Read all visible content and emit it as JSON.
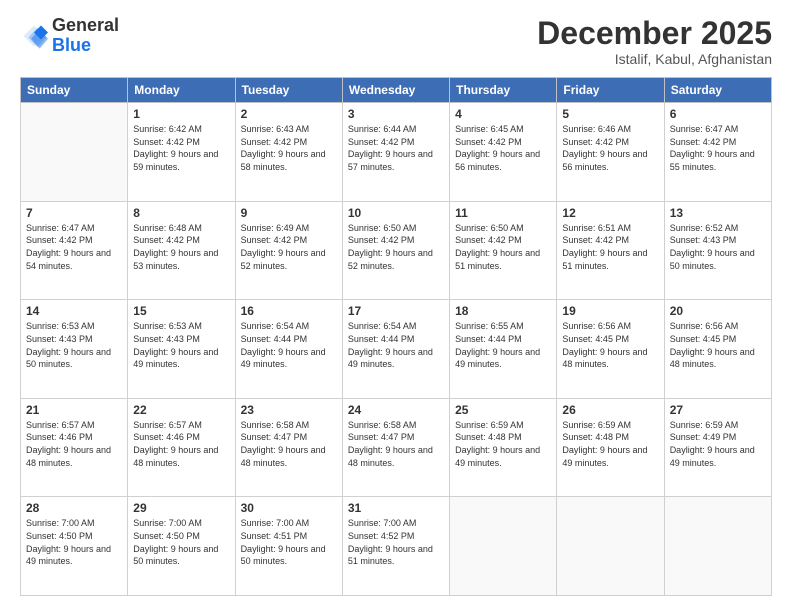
{
  "header": {
    "logo_general": "General",
    "logo_blue": "Blue",
    "month_title": "December 2025",
    "location": "Istalif, Kabul, Afghanistan"
  },
  "days_of_week": [
    "Sunday",
    "Monday",
    "Tuesday",
    "Wednesday",
    "Thursday",
    "Friday",
    "Saturday"
  ],
  "weeks": [
    [
      {
        "day": "",
        "info": ""
      },
      {
        "day": "1",
        "info": "Sunrise: 6:42 AM\nSunset: 4:42 PM\nDaylight: 9 hours\nand 59 minutes."
      },
      {
        "day": "2",
        "info": "Sunrise: 6:43 AM\nSunset: 4:42 PM\nDaylight: 9 hours\nand 58 minutes."
      },
      {
        "day": "3",
        "info": "Sunrise: 6:44 AM\nSunset: 4:42 PM\nDaylight: 9 hours\nand 57 minutes."
      },
      {
        "day": "4",
        "info": "Sunrise: 6:45 AM\nSunset: 4:42 PM\nDaylight: 9 hours\nand 56 minutes."
      },
      {
        "day": "5",
        "info": "Sunrise: 6:46 AM\nSunset: 4:42 PM\nDaylight: 9 hours\nand 56 minutes."
      },
      {
        "day": "6",
        "info": "Sunrise: 6:47 AM\nSunset: 4:42 PM\nDaylight: 9 hours\nand 55 minutes."
      }
    ],
    [
      {
        "day": "7",
        "info": "Sunrise: 6:47 AM\nSunset: 4:42 PM\nDaylight: 9 hours\nand 54 minutes."
      },
      {
        "day": "8",
        "info": "Sunrise: 6:48 AM\nSunset: 4:42 PM\nDaylight: 9 hours\nand 53 minutes."
      },
      {
        "day": "9",
        "info": "Sunrise: 6:49 AM\nSunset: 4:42 PM\nDaylight: 9 hours\nand 52 minutes."
      },
      {
        "day": "10",
        "info": "Sunrise: 6:50 AM\nSunset: 4:42 PM\nDaylight: 9 hours\nand 52 minutes."
      },
      {
        "day": "11",
        "info": "Sunrise: 6:50 AM\nSunset: 4:42 PM\nDaylight: 9 hours\nand 51 minutes."
      },
      {
        "day": "12",
        "info": "Sunrise: 6:51 AM\nSunset: 4:42 PM\nDaylight: 9 hours\nand 51 minutes."
      },
      {
        "day": "13",
        "info": "Sunrise: 6:52 AM\nSunset: 4:43 PM\nDaylight: 9 hours\nand 50 minutes."
      }
    ],
    [
      {
        "day": "14",
        "info": "Sunrise: 6:53 AM\nSunset: 4:43 PM\nDaylight: 9 hours\nand 50 minutes."
      },
      {
        "day": "15",
        "info": "Sunrise: 6:53 AM\nSunset: 4:43 PM\nDaylight: 9 hours\nand 49 minutes."
      },
      {
        "day": "16",
        "info": "Sunrise: 6:54 AM\nSunset: 4:44 PM\nDaylight: 9 hours\nand 49 minutes."
      },
      {
        "day": "17",
        "info": "Sunrise: 6:54 AM\nSunset: 4:44 PM\nDaylight: 9 hours\nand 49 minutes."
      },
      {
        "day": "18",
        "info": "Sunrise: 6:55 AM\nSunset: 4:44 PM\nDaylight: 9 hours\nand 49 minutes."
      },
      {
        "day": "19",
        "info": "Sunrise: 6:56 AM\nSunset: 4:45 PM\nDaylight: 9 hours\nand 48 minutes."
      },
      {
        "day": "20",
        "info": "Sunrise: 6:56 AM\nSunset: 4:45 PM\nDaylight: 9 hours\nand 48 minutes."
      }
    ],
    [
      {
        "day": "21",
        "info": "Sunrise: 6:57 AM\nSunset: 4:46 PM\nDaylight: 9 hours\nand 48 minutes."
      },
      {
        "day": "22",
        "info": "Sunrise: 6:57 AM\nSunset: 4:46 PM\nDaylight: 9 hours\nand 48 minutes."
      },
      {
        "day": "23",
        "info": "Sunrise: 6:58 AM\nSunset: 4:47 PM\nDaylight: 9 hours\nand 48 minutes."
      },
      {
        "day": "24",
        "info": "Sunrise: 6:58 AM\nSunset: 4:47 PM\nDaylight: 9 hours\nand 48 minutes."
      },
      {
        "day": "25",
        "info": "Sunrise: 6:59 AM\nSunset: 4:48 PM\nDaylight: 9 hours\nand 49 minutes."
      },
      {
        "day": "26",
        "info": "Sunrise: 6:59 AM\nSunset: 4:48 PM\nDaylight: 9 hours\nand 49 minutes."
      },
      {
        "day": "27",
        "info": "Sunrise: 6:59 AM\nSunset: 4:49 PM\nDaylight: 9 hours\nand 49 minutes."
      }
    ],
    [
      {
        "day": "28",
        "info": "Sunrise: 7:00 AM\nSunset: 4:50 PM\nDaylight: 9 hours\nand 49 minutes."
      },
      {
        "day": "29",
        "info": "Sunrise: 7:00 AM\nSunset: 4:50 PM\nDaylight: 9 hours\nand 50 minutes."
      },
      {
        "day": "30",
        "info": "Sunrise: 7:00 AM\nSunset: 4:51 PM\nDaylight: 9 hours\nand 50 minutes."
      },
      {
        "day": "31",
        "info": "Sunrise: 7:00 AM\nSunset: 4:52 PM\nDaylight: 9 hours\nand 51 minutes."
      },
      {
        "day": "",
        "info": ""
      },
      {
        "day": "",
        "info": ""
      },
      {
        "day": "",
        "info": ""
      }
    ]
  ]
}
